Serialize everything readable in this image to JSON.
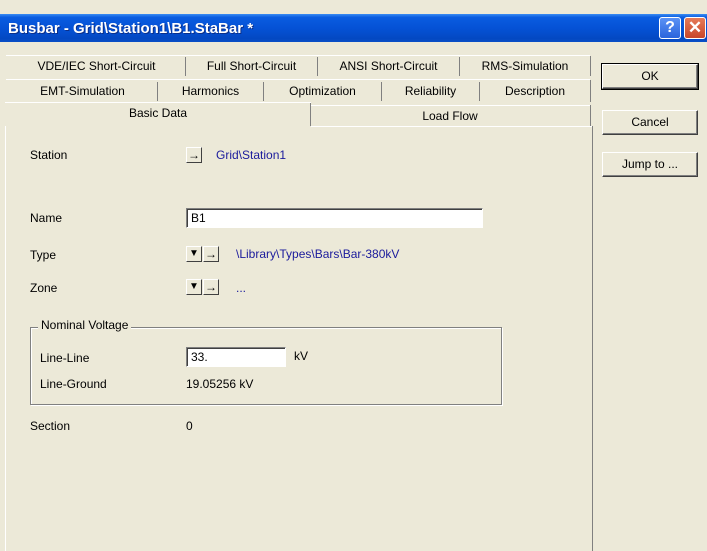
{
  "window": {
    "title": "Busbar - Grid\\Station1\\B1.StaBar *",
    "help_label": "?",
    "close_label": "✕"
  },
  "tabs": {
    "row1": [
      "VDE/IEC Short-Circuit",
      "Full Short-Circuit",
      "ANSI Short-Circuit",
      "RMS-Simulation"
    ],
    "row2": [
      "EMT-Simulation",
      "Harmonics",
      "Optimization",
      "Reliability",
      "Description"
    ],
    "row3": [
      "Basic Data",
      "Load Flow"
    ],
    "active": "Basic Data"
  },
  "form": {
    "station_label": "Station",
    "station_value": "Grid\\Station1",
    "name_label": "Name",
    "name_value": "B1",
    "type_label": "Type",
    "type_value": "\\Library\\Types\\Bars\\Bar-380kV",
    "zone_label": "Zone",
    "zone_value": "...",
    "nominal_voltage_title": "Nominal Voltage",
    "line_line_label": "Line-Line",
    "line_line_value": "33.",
    "line_line_unit": "kV",
    "line_ground_label": "Line-Ground",
    "line_ground_value": "19.05256 kV",
    "section_label": "Section",
    "section_value": "0"
  },
  "buttons": {
    "ok": "OK",
    "cancel": "Cancel",
    "jump": "Jump to ..."
  },
  "icons": {
    "arrow_right": "→",
    "triangle_down": "▼"
  }
}
